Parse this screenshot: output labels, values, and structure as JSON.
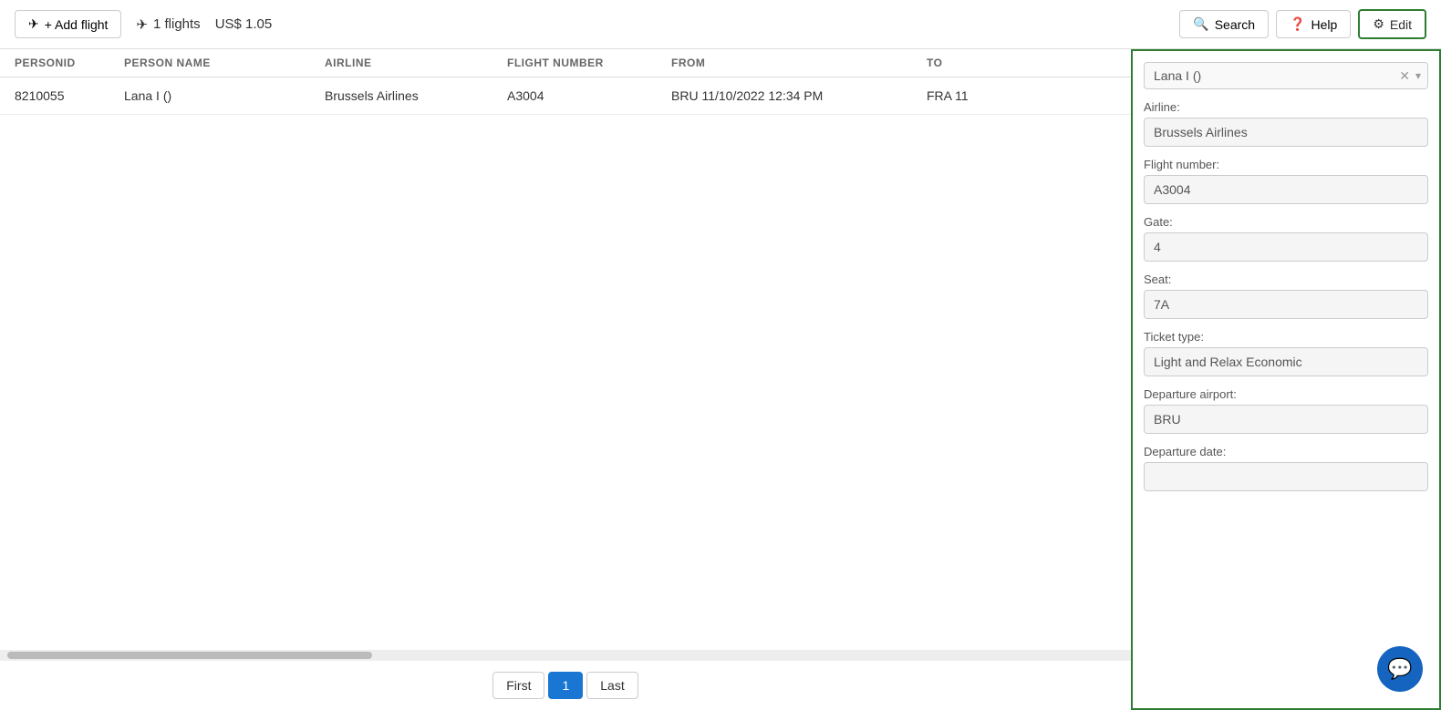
{
  "topbar": {
    "add_flight_label": "+ Add flight",
    "flights_count_label": "1 flights",
    "cost_label": "US$ 1.05",
    "search_label": "Search",
    "help_label": "Help",
    "edit_label": "Edit"
  },
  "table": {
    "columns": [
      "PERSONID",
      "PERSON NAME",
      "AIRLINE",
      "FLIGHT NUMBER",
      "FROM",
      "TO"
    ],
    "rows": [
      {
        "personid": "8210055",
        "person_name": "Lana I ()",
        "airline": "Brussels Airlines",
        "flight_number": "A3004",
        "from": "BRU 11/10/2022 12:34 PM",
        "to": "FRA 11"
      }
    ]
  },
  "pagination": {
    "first_label": "First",
    "page_label": "1",
    "last_label": "Last"
  },
  "right_panel": {
    "search_value": "Lana I ()",
    "airline_label": "Airline:",
    "airline_value": "Brussels Airlines",
    "flight_number_label": "Flight number:",
    "flight_number_value": "A3004",
    "gate_label": "Gate:",
    "gate_value": "4",
    "seat_label": "Seat:",
    "seat_value": "7A",
    "ticket_type_label": "Ticket type:",
    "ticket_type_value": "Light and Relax Economic",
    "departure_airport_label": "Departure airport:",
    "departure_airport_value": "BRU",
    "departure_date_label": "Departure date:"
  }
}
